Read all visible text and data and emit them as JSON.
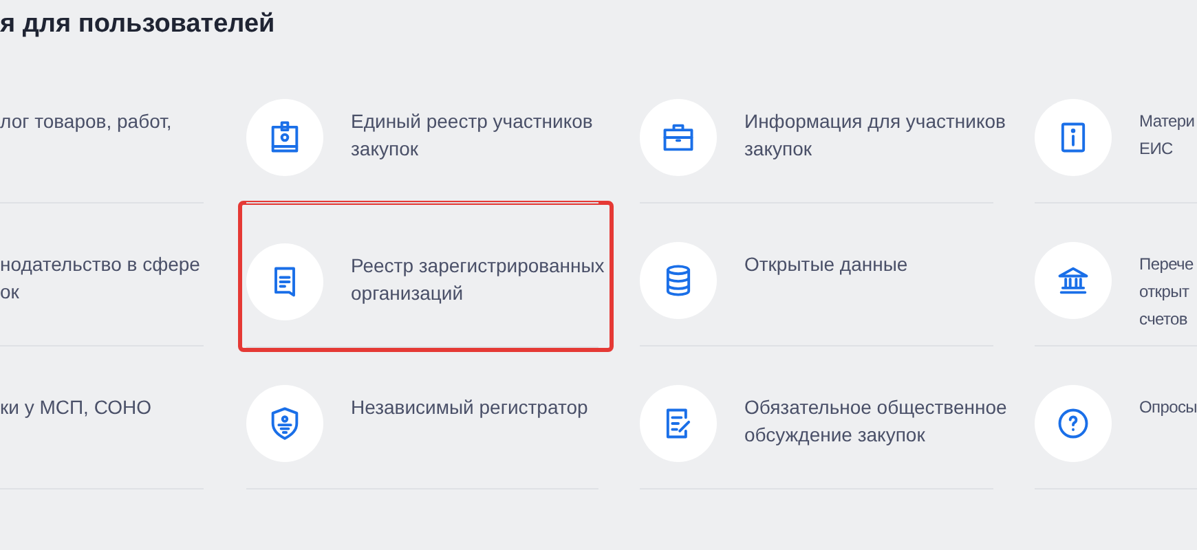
{
  "heading": "я для пользователей",
  "columns": [
    {
      "items": [
        {
          "kind": "text-only",
          "lines": [
            "лог товаров, работ,"
          ],
          "highlighted": false
        },
        {
          "kind": "text-only",
          "lines": [
            "нодательство в сфере",
            "ок"
          ],
          "highlighted": false
        },
        {
          "kind": "text-only",
          "lines": [
            "ки у МСП, СОНО"
          ],
          "highlighted": false
        }
      ]
    },
    {
      "items": [
        {
          "kind": "icon-item",
          "lines": [
            "Единый реестр участников",
            "закупок"
          ],
          "highlighted": false
        },
        {
          "kind": "icon-item",
          "lines": [
            "Реестр зарегистрированных",
            "организаций"
          ],
          "highlighted": true
        },
        {
          "kind": "icon-item",
          "lines": [
            "Независимый регистратор"
          ],
          "highlighted": false
        }
      ]
    },
    {
      "items": [
        {
          "kind": "icon-item",
          "lines": [
            "Информация для участников",
            "закупок"
          ],
          "highlighted": false
        },
        {
          "kind": "icon-item",
          "lines": [
            "Открытые данные"
          ],
          "highlighted": false
        },
        {
          "kind": "icon-item",
          "lines": [
            "Обязательное общественное",
            "обсуждение закупок"
          ],
          "highlighted": false
        }
      ]
    },
    {
      "items": [
        {
          "kind": "icon-item",
          "lines": [
            "Матери",
            "ЕИС"
          ],
          "highlighted": false
        },
        {
          "kind": "icon-item",
          "lines": [
            "Перече",
            "открыт",
            "счетов"
          ],
          "highlighted": false
        },
        {
          "kind": "icon-item",
          "lines": [
            "Опросы"
          ],
          "highlighted": false
        }
      ]
    }
  ]
}
